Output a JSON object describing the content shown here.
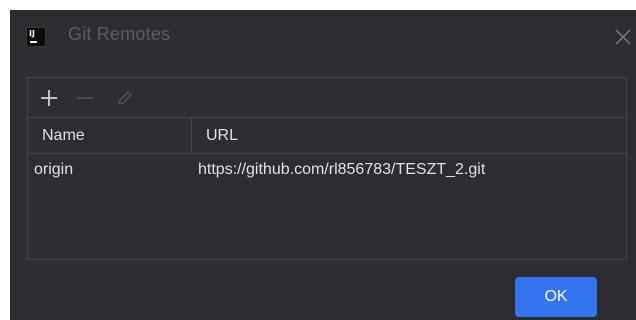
{
  "window": {
    "title": "Git Remotes",
    "app_icon_text": "IJ"
  },
  "toolbar": {
    "add_icon": "plus-icon",
    "remove_icon": "minus-icon",
    "edit_icon": "pencil-icon"
  },
  "table": {
    "columns": [
      "Name",
      "URL"
    ],
    "rows": [
      {
        "name": "origin",
        "url": "https://github.com/rl856783/TESZT_2.git"
      }
    ]
  },
  "buttons": {
    "ok_label": "OK"
  },
  "colors": {
    "background": "#2b2d30",
    "border": "#43454a",
    "text": "#dfe1e5",
    "title_text": "#5a5d63",
    "accent": "#3574f0"
  }
}
